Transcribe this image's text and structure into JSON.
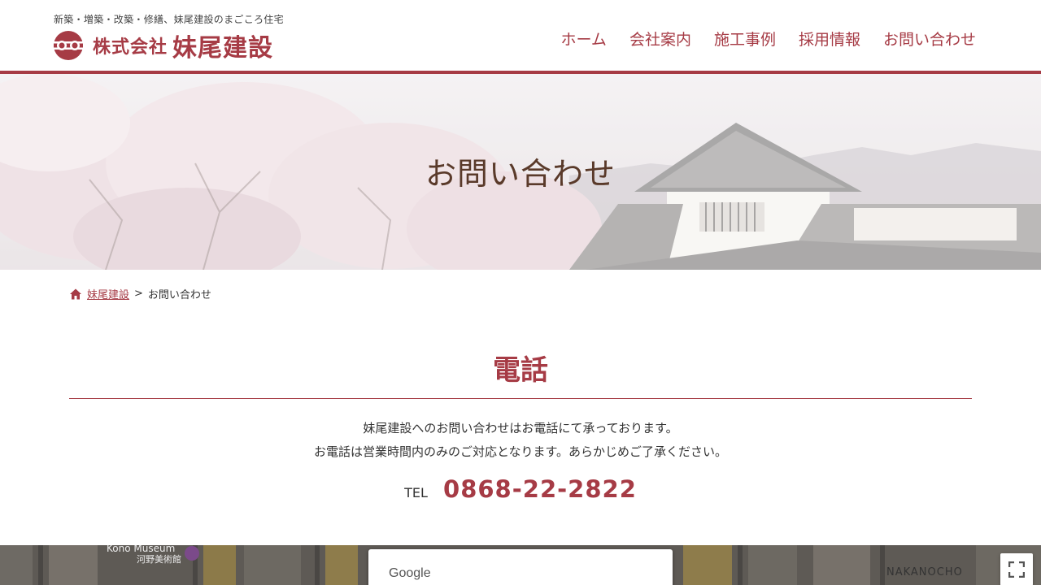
{
  "header": {
    "tagline": "新築・増築・改築・修繕、妹尾建設のまごころ住宅",
    "logo_sub": "株式会社",
    "logo_main": "妹尾建設"
  },
  "nav": {
    "items": [
      {
        "label": "ホーム"
      },
      {
        "label": "会社案内"
      },
      {
        "label": "施工事例"
      },
      {
        "label": "採用情報"
      },
      {
        "label": "お問い合わせ"
      }
    ]
  },
  "hero": {
    "title": "お問い合わせ"
  },
  "breadcrumb": {
    "home_label": "妹尾建設",
    "separator": ">",
    "current": "お問い合わせ"
  },
  "section": {
    "title": "電話",
    "line1": "妹尾建設へのお問い合わせはお電話にて承っております。",
    "line2": "お電話は営業時間内のみのご対応となります。あらかじめご了承ください。",
    "tel_label": "TEL",
    "tel_number": "0868-22-2822"
  },
  "map": {
    "label_museum": "Kono Museum",
    "label_museum_jp": "河野美術館",
    "label_area": "NAKANOCHO",
    "google_text": "Google"
  },
  "colors": {
    "accent": "#a63b45",
    "hero_title": "#5a3a2a"
  }
}
